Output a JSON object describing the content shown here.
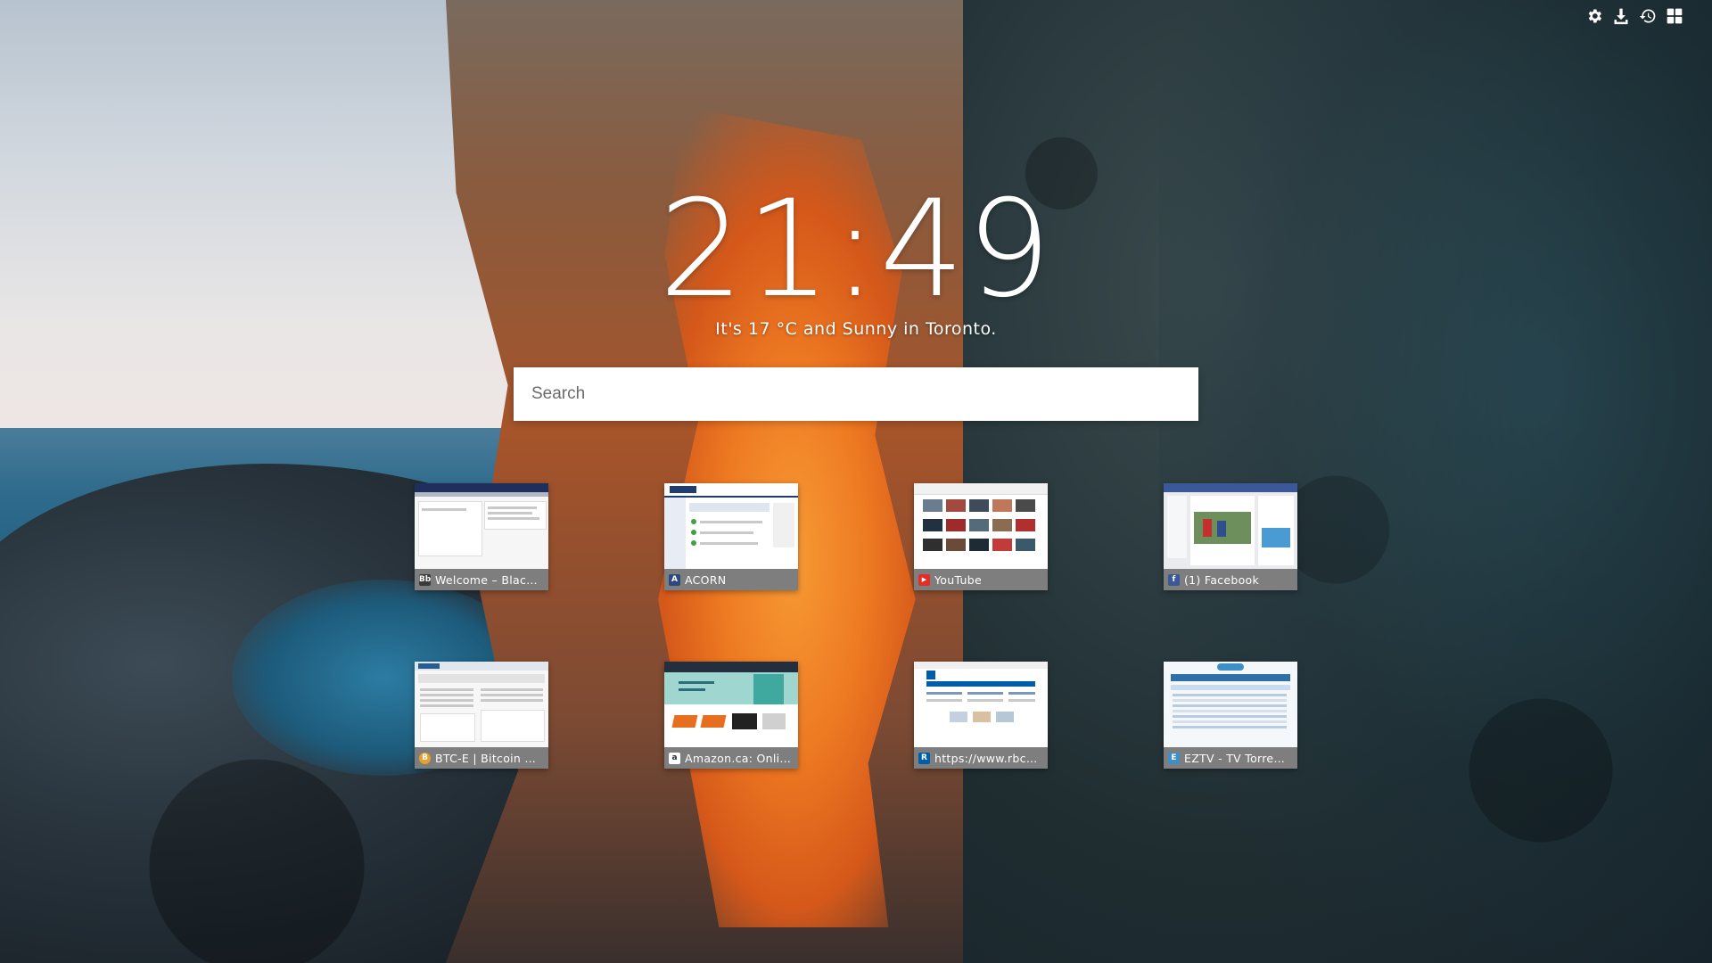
{
  "clock": {
    "time": "21:49"
  },
  "weather": {
    "text": "It's 17 °C and Sunny in Toronto."
  },
  "search": {
    "placeholder": "Search"
  },
  "toolbar": {
    "buttons": [
      {
        "icon": "gear-icon"
      },
      {
        "icon": "download-icon"
      },
      {
        "icon": "history-icon"
      },
      {
        "icon": "grid-icon"
      }
    ]
  },
  "tiles": [
    {
      "title": "Welcome – Blac…",
      "favicon": "Bb",
      "favicon_color": "#3a3a3a"
    },
    {
      "title": "ACORN",
      "favicon": "A",
      "favicon_color": "#2b4a80"
    },
    {
      "title": "YouTube",
      "favicon": "▶",
      "favicon_color": "#e52d27"
    },
    {
      "title": "(1) Facebook",
      "favicon": "f",
      "favicon_color": "#3b5998"
    },
    {
      "title": "BTC-E | Bitcoin …",
      "favicon": "B",
      "favicon_color": "#e5a22b"
    },
    {
      "title": "Amazon.ca: Onli…",
      "favicon": "a",
      "favicon_color": "#232f3e"
    },
    {
      "title": "https://www.rbc…",
      "favicon": "R",
      "favicon_color": "#005daa"
    },
    {
      "title": "EZTV - TV Torre…",
      "favicon": "E",
      "favicon_color": "#3c8fc7"
    }
  ]
}
